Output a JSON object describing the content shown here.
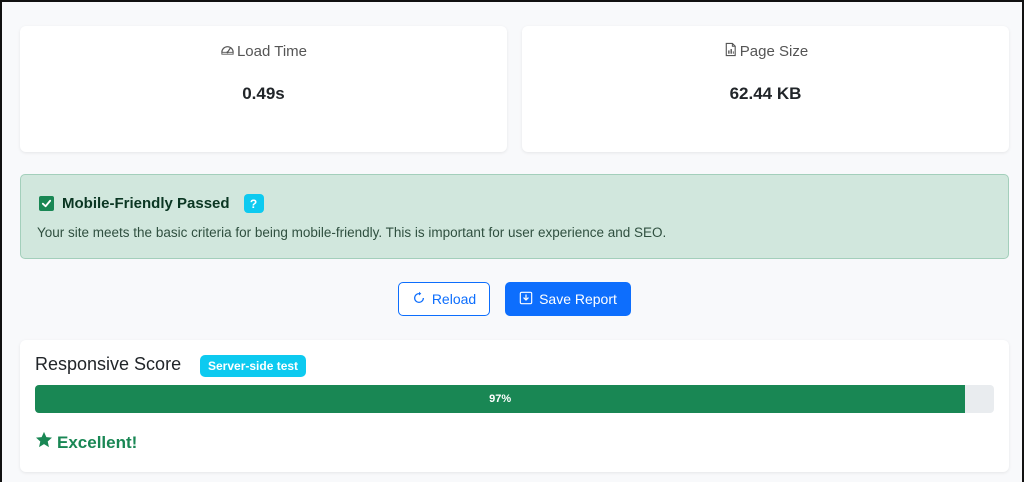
{
  "stats": {
    "load_time": {
      "label": "Load Time",
      "value": "0.49s",
      "icon": "speedometer-icon"
    },
    "page_size": {
      "label": "Page Size",
      "value": "62.44 KB",
      "icon": "file-icon"
    }
  },
  "alert": {
    "title": "Mobile-Friendly Passed",
    "help": "?",
    "text": "Your site meets the basic criteria for being mobile-friendly. This is important for user experience and SEO.",
    "icon": "check-square-icon"
  },
  "actions": {
    "reload_label": "Reload",
    "save_label": "Save Report"
  },
  "score": {
    "title": "Responsive Score",
    "badge": "Server-side test",
    "percent": 97,
    "percent_label": "97%",
    "verdict": "Excellent!",
    "verdict_icon": "star-icon"
  },
  "colors": {
    "success": "#198754",
    "primary": "#0d6efd",
    "info": "#0dcaf0",
    "alert_bg": "#d1e7dd"
  }
}
